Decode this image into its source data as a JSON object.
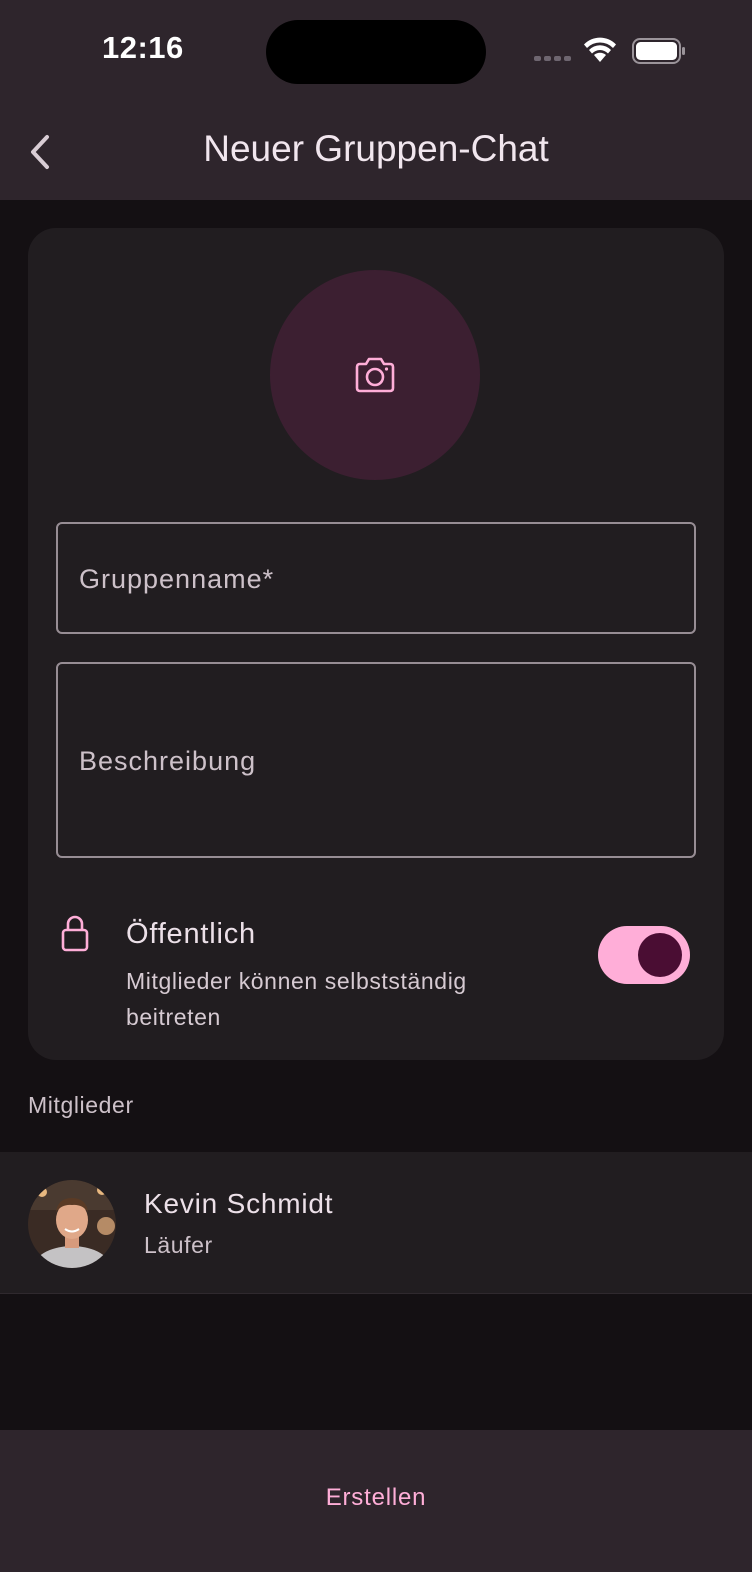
{
  "status_bar": {
    "time": "12:16"
  },
  "header": {
    "title": "Neuer Gruppen-Chat"
  },
  "form": {
    "group_name_placeholder": "Gruppenname*",
    "description_placeholder": "Beschreibung",
    "public_toggle": {
      "title": "Öffentlich",
      "subtitle": "Mitglieder können selbstständig beitreten",
      "enabled": true
    }
  },
  "members": {
    "section_label": "Mitglieder",
    "items": [
      {
        "name": "Kevin Schmidt",
        "role": "Läufer"
      }
    ]
  },
  "footer": {
    "create_label": "Erstellen"
  },
  "colors": {
    "accent": "#ffaed8",
    "surface": "#211d20",
    "background": "#141013",
    "bar": "#2e252c",
    "avatar_bg": "#3c1f31"
  },
  "icons": [
    "back-chevron-icon",
    "camera-icon",
    "lock-icon",
    "wifi-icon",
    "battery-icon"
  ]
}
